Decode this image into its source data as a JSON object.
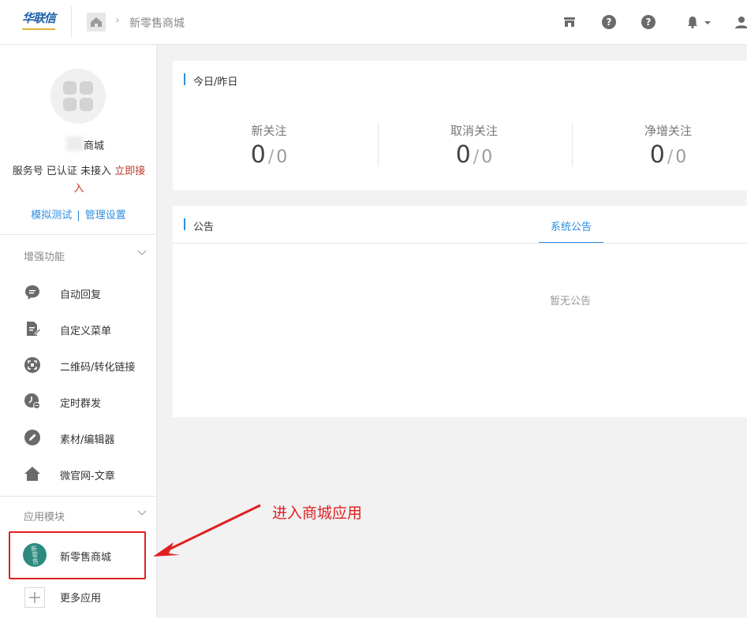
{
  "header": {
    "logo_text": "华联信",
    "breadcrumb_title": "新零售商城",
    "icons": [
      "home-icon",
      "store-icon",
      "help-icon",
      "help-icon",
      "bell-icon",
      "chevron-down-icon",
      "user-icon"
    ]
  },
  "sidebar": {
    "shop_name": "商城",
    "status_prefix": "服务号 已认证 未接入 ",
    "connect_link": "立即接入",
    "simulate_link": "模拟测试",
    "link_sep": "|",
    "settings_link": "管理设置",
    "enhanced": {
      "title": "增强功能",
      "items": [
        {
          "label": "自动回复",
          "icon": "chat-icon"
        },
        {
          "label": "自定义菜单",
          "icon": "document-edit-icon"
        },
        {
          "label": "二维码/转化链接",
          "icon": "qrcode-scan-icon"
        },
        {
          "label": "定时群发",
          "icon": "clock-icon"
        },
        {
          "label": "素材/编辑器",
          "icon": "pencil-icon"
        },
        {
          "label": "微官网-文章",
          "icon": "home-icon"
        }
      ]
    },
    "modules": {
      "title": "应用模块",
      "items": [
        {
          "label": "新零售商城",
          "icon": "app-logo-icon"
        },
        {
          "label": "更多应用",
          "icon": "plus-icon"
        }
      ]
    }
  },
  "stats_panel": {
    "title": "今日/昨日",
    "stats": [
      {
        "label": "新关注",
        "today": "0",
        "yesterday": "0"
      },
      {
        "label": "取消关注",
        "today": "0",
        "yesterday": "0"
      },
      {
        "label": "净增关注",
        "today": "0",
        "yesterday": "0"
      }
    ]
  },
  "notice_panel": {
    "title": "公告",
    "tab": "系统公告",
    "empty": "暂无公告"
  },
  "annotation": {
    "text": "进入商城应用",
    "color": "#e02020"
  },
  "colors": {
    "accent": "#2d8ee0",
    "highlight": "#e02020",
    "link_red": "#c0392b"
  }
}
